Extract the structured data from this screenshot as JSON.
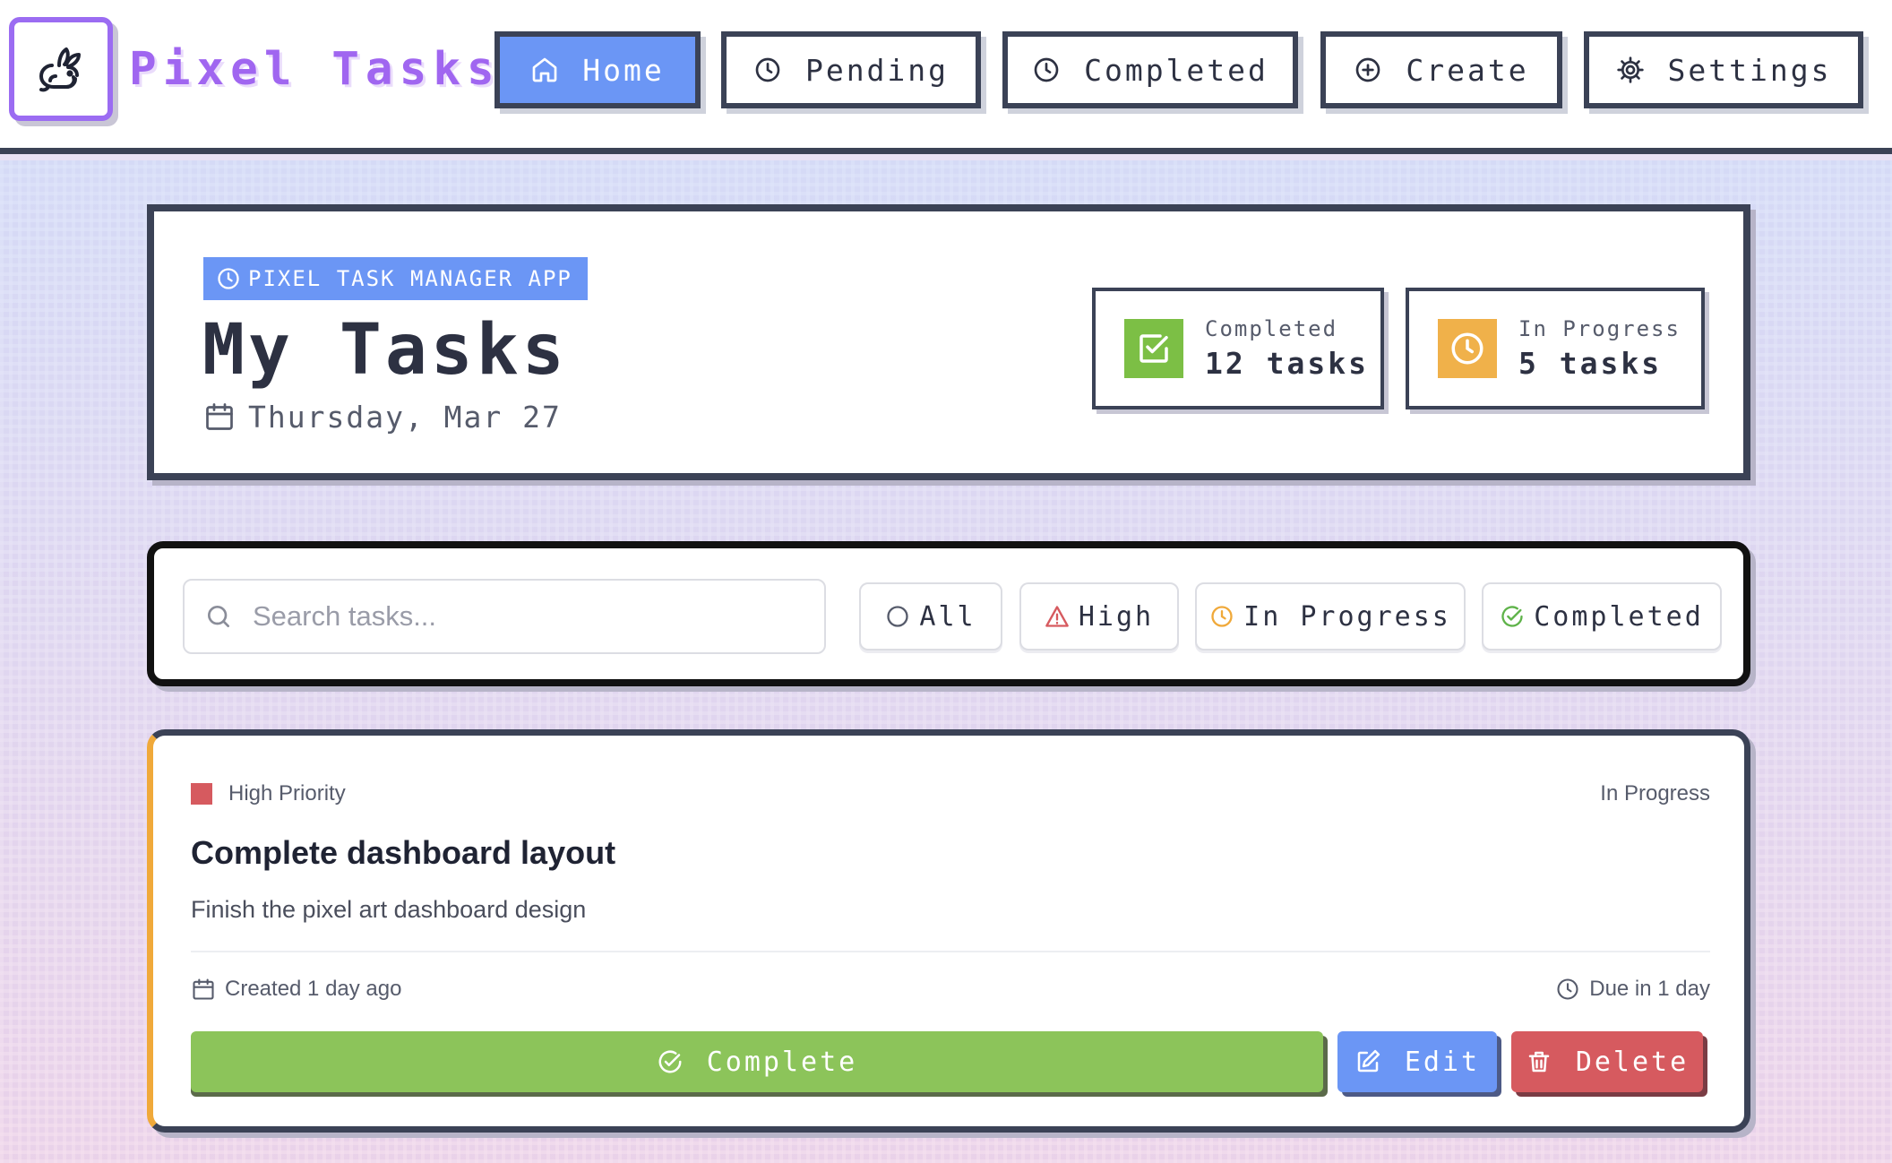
{
  "app": {
    "name": "Pixel Tasks",
    "brand_color": "#a066f0",
    "accent_color": "#6b96f5"
  },
  "nav": {
    "items": [
      {
        "label": "Home",
        "icon": "home-icon",
        "active": true
      },
      {
        "label": "Pending",
        "icon": "clock-icon",
        "active": false
      },
      {
        "label": "Completed",
        "icon": "clock-icon",
        "active": false
      },
      {
        "label": "Create",
        "icon": "plus-circle-icon",
        "active": false
      },
      {
        "label": "Settings",
        "icon": "gear-icon",
        "active": false
      }
    ]
  },
  "header": {
    "tag": "PIXEL TASK MANAGER APP",
    "title": "My Tasks",
    "date": "Thursday, Mar 27",
    "stats": [
      {
        "label": "Completed",
        "value": "12 tasks",
        "icon": "check-square-icon",
        "color": "#7cbf45"
      },
      {
        "label": "In Progress",
        "value": "5 tasks",
        "icon": "clock-icon",
        "color": "#f0b14a"
      }
    ]
  },
  "filters": {
    "search_placeholder": "Search tasks...",
    "search_value": "",
    "chips": [
      {
        "label": "All",
        "icon": "circle-icon"
      },
      {
        "label": "High",
        "icon": "warning-icon",
        "color": "#d65a5f"
      },
      {
        "label": "In Progress",
        "icon": "clock-icon",
        "color": "#f0a93a"
      },
      {
        "label": "Completed",
        "icon": "check-circle-icon",
        "color": "#5fb34a"
      }
    ]
  },
  "tasks": [
    {
      "priority": "High Priority",
      "priority_color": "#d65a5f",
      "status": "In Progress",
      "title": "Complete dashboard layout",
      "description": "Finish the pixel art dashboard design",
      "created": "Created 1 day ago",
      "due": "Due in 1 day",
      "actions": {
        "complete": "Complete",
        "edit": "Edit",
        "delete": "Delete"
      }
    }
  ]
}
